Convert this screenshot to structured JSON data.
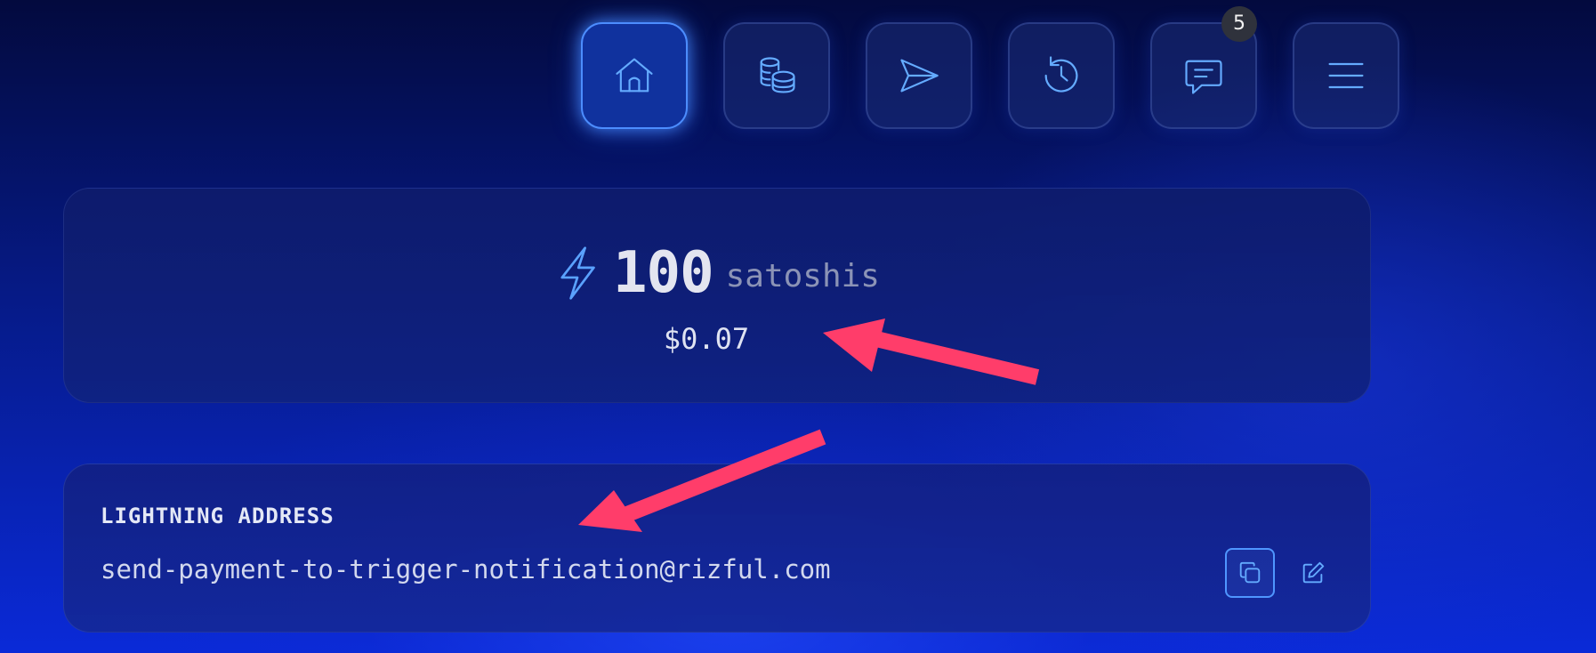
{
  "colors": {
    "accent": "#64abff",
    "active_border": "#4c8dff",
    "arrow": "#ff3d6a",
    "badge_bg": "#2f323c"
  },
  "nav": {
    "items": [
      {
        "id": "home",
        "icon": "home-icon",
        "active": true
      },
      {
        "id": "coins",
        "icon": "coins-icon",
        "active": false
      },
      {
        "id": "send",
        "icon": "send-icon",
        "active": false
      },
      {
        "id": "history",
        "icon": "history-icon",
        "active": false
      },
      {
        "id": "messages",
        "icon": "chat-icon",
        "active": false,
        "badge": "5"
      },
      {
        "id": "menu",
        "icon": "menu-icon",
        "active": false
      }
    ]
  },
  "balance": {
    "amount": "100",
    "unit": "satoshis",
    "fiat": "$0.07",
    "icon": "lightning-bolt-icon"
  },
  "lightning_address": {
    "label": "LIGHTNING ADDRESS",
    "value": "send-payment-to-trigger-notification@rizful.com",
    "copy_icon": "copy-icon",
    "edit_icon": "edit-icon"
  }
}
